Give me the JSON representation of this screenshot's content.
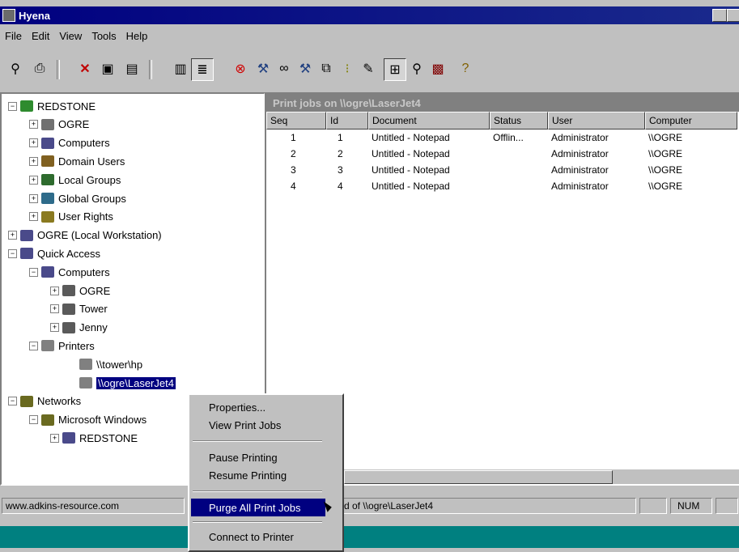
{
  "window": {
    "title": "Hyena"
  },
  "menu": [
    "File",
    "Edit",
    "View",
    "Tools",
    "Help"
  ],
  "toolbar_icons": [
    "connect-icon",
    "print-icon",
    "delete-icon",
    "properties-icon",
    "refresh-icon",
    "list-view-icon",
    "details-view-icon",
    "stop-icon",
    "tool-icon",
    "binoculars-icon",
    "tool2-icon",
    "copy-icon",
    "tree-icon",
    "pencil-icon",
    "network-icon",
    "connect2-icon",
    "monitor-icon",
    "help-icon"
  ],
  "tree": {
    "items": [
      {
        "label": "REDSTONE",
        "exp": "−",
        "icon": "domain-icon",
        "color": "#2e8b2e"
      },
      {
        "label": "OGRE",
        "exp": "+",
        "icon": "server-icon",
        "color": "#707070"
      },
      {
        "label": "Computers",
        "exp": "+",
        "icon": "computers-icon",
        "color": "#4a4a8a"
      },
      {
        "label": "Domain Users",
        "exp": "+",
        "icon": "users-icon",
        "color": "#806020"
      },
      {
        "label": "Local Groups",
        "exp": "+",
        "icon": "group-icon",
        "color": "#2e6b2e"
      },
      {
        "label": "Global Groups",
        "exp": "+",
        "icon": "group-icon",
        "color": "#2e6b8a"
      },
      {
        "label": "User Rights",
        "exp": "+",
        "icon": "rights-icon",
        "color": "#8a7a20"
      },
      {
        "label": "OGRE (Local Workstation)",
        "exp": "+",
        "icon": "workstation-icon",
        "color": "#4a4a8a"
      },
      {
        "label": "Quick Access",
        "exp": "−",
        "icon": "quick-access-icon",
        "color": "#4a4a8a"
      },
      {
        "label": "Computers",
        "exp": "−",
        "icon": "computers-icon",
        "color": "#4a4a8a"
      },
      {
        "label": "OGRE",
        "exp": "+",
        "icon": "computer-icon",
        "color": "#5a5a5a"
      },
      {
        "label": "Tower",
        "exp": "+",
        "icon": "computer-icon",
        "color": "#5a5a5a"
      },
      {
        "label": "Jenny",
        "exp": "+",
        "icon": "computer-icon",
        "color": "#5a5a5a"
      },
      {
        "label": "Printers",
        "exp": "−",
        "icon": "printer-icon",
        "color": "#808080"
      },
      {
        "label": "\\\\tower\\hp",
        "exp": "",
        "icon": "printer-icon",
        "color": "#808080"
      },
      {
        "label": "\\\\ogre\\LaserJet4",
        "exp": "",
        "icon": "printer-icon",
        "color": "#808080"
      },
      {
        "label": "Networks",
        "exp": "−",
        "icon": "network-icon",
        "color": "#6a6a20"
      },
      {
        "label": "Microsoft Windows",
        "exp": "−",
        "icon": "network-icon",
        "color": "#6a6a20"
      },
      {
        "label": "REDSTONE",
        "exp": "+",
        "icon": "domain-tree-icon",
        "color": "#4a4a8a"
      }
    ]
  },
  "pane": {
    "title": "Print jobs on \\\\ogre\\LaserJet4",
    "columns": [
      "Seq",
      "Id",
      "Document",
      "Status",
      "User",
      "Computer"
    ],
    "rows": [
      [
        "1",
        "1",
        "Untitled - Notepad",
        "Offlin...",
        "Administrator",
        "\\\\OGRE"
      ],
      [
        "2",
        "2",
        "Untitled - Notepad",
        "",
        "Administrator",
        "\\\\OGRE"
      ],
      [
        "3",
        "3",
        "Untitled - Notepad",
        "",
        "Administrator",
        "\\\\OGRE"
      ],
      [
        "4",
        "4",
        "Untitled - Notepad",
        "",
        "Administrator",
        "\\\\OGRE"
      ]
    ]
  },
  "context_menu": {
    "properties": "Properties...",
    "view_jobs": "View Print Jobs",
    "pause": "Pause Printing",
    "resume": "Resume Printing",
    "purge": "Purge All Print Jobs",
    "connect": "Connect to Printer"
  },
  "status": {
    "url": "www.adkins-resource.com",
    "message": "d of \\\\ogre\\LaserJet4",
    "num": "NUM"
  }
}
